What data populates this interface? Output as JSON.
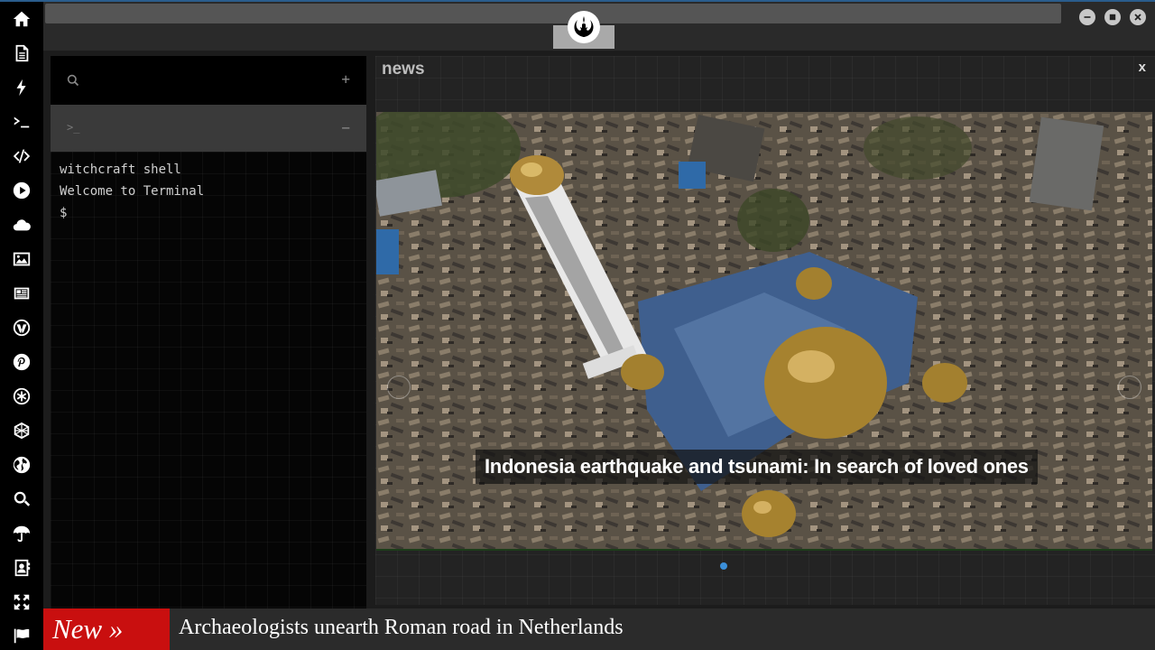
{
  "window": {
    "logo_icon": "rebel-alliance-icon",
    "controls": [
      "minimize-icon",
      "maximize-icon",
      "close-icon"
    ]
  },
  "sidebar": {
    "items": [
      {
        "icon": "home-icon"
      },
      {
        "icon": "document-icon"
      },
      {
        "icon": "lightning-icon"
      },
      {
        "icon": "terminal-icon"
      },
      {
        "icon": "code-icon"
      },
      {
        "icon": "play-icon"
      },
      {
        "icon": "cloud-icon"
      },
      {
        "icon": "image-icon"
      },
      {
        "icon": "newspaper-icon"
      },
      {
        "icon": "wordpress-icon"
      },
      {
        "icon": "pinterest-icon"
      },
      {
        "icon": "asterisk-icon"
      },
      {
        "icon": "network-icon"
      },
      {
        "icon": "globe-icon"
      },
      {
        "icon": "search-icon"
      },
      {
        "icon": "umbrella-icon"
      },
      {
        "icon": "contact-card-icon"
      },
      {
        "icon": "expand-icon"
      },
      {
        "icon": "flag-icon"
      }
    ]
  },
  "terminal": {
    "search_icon": "search-icon",
    "add_label": "+",
    "tab_prompt": ">_",
    "collapse_label": "−",
    "lines": [
      "witchcraft shell",
      "Welcome to Terminal",
      "$"
    ]
  },
  "news": {
    "title": "news",
    "close_label": "x",
    "caption": "Indonesia earthquake and tsunami: In search of loved ones",
    "active_dot_color": "#3b8fd9"
  },
  "ticker": {
    "label": "New »",
    "headline": "Archaeologists unearth Roman road in Netherlands",
    "badge_color": "#c90f0f"
  }
}
